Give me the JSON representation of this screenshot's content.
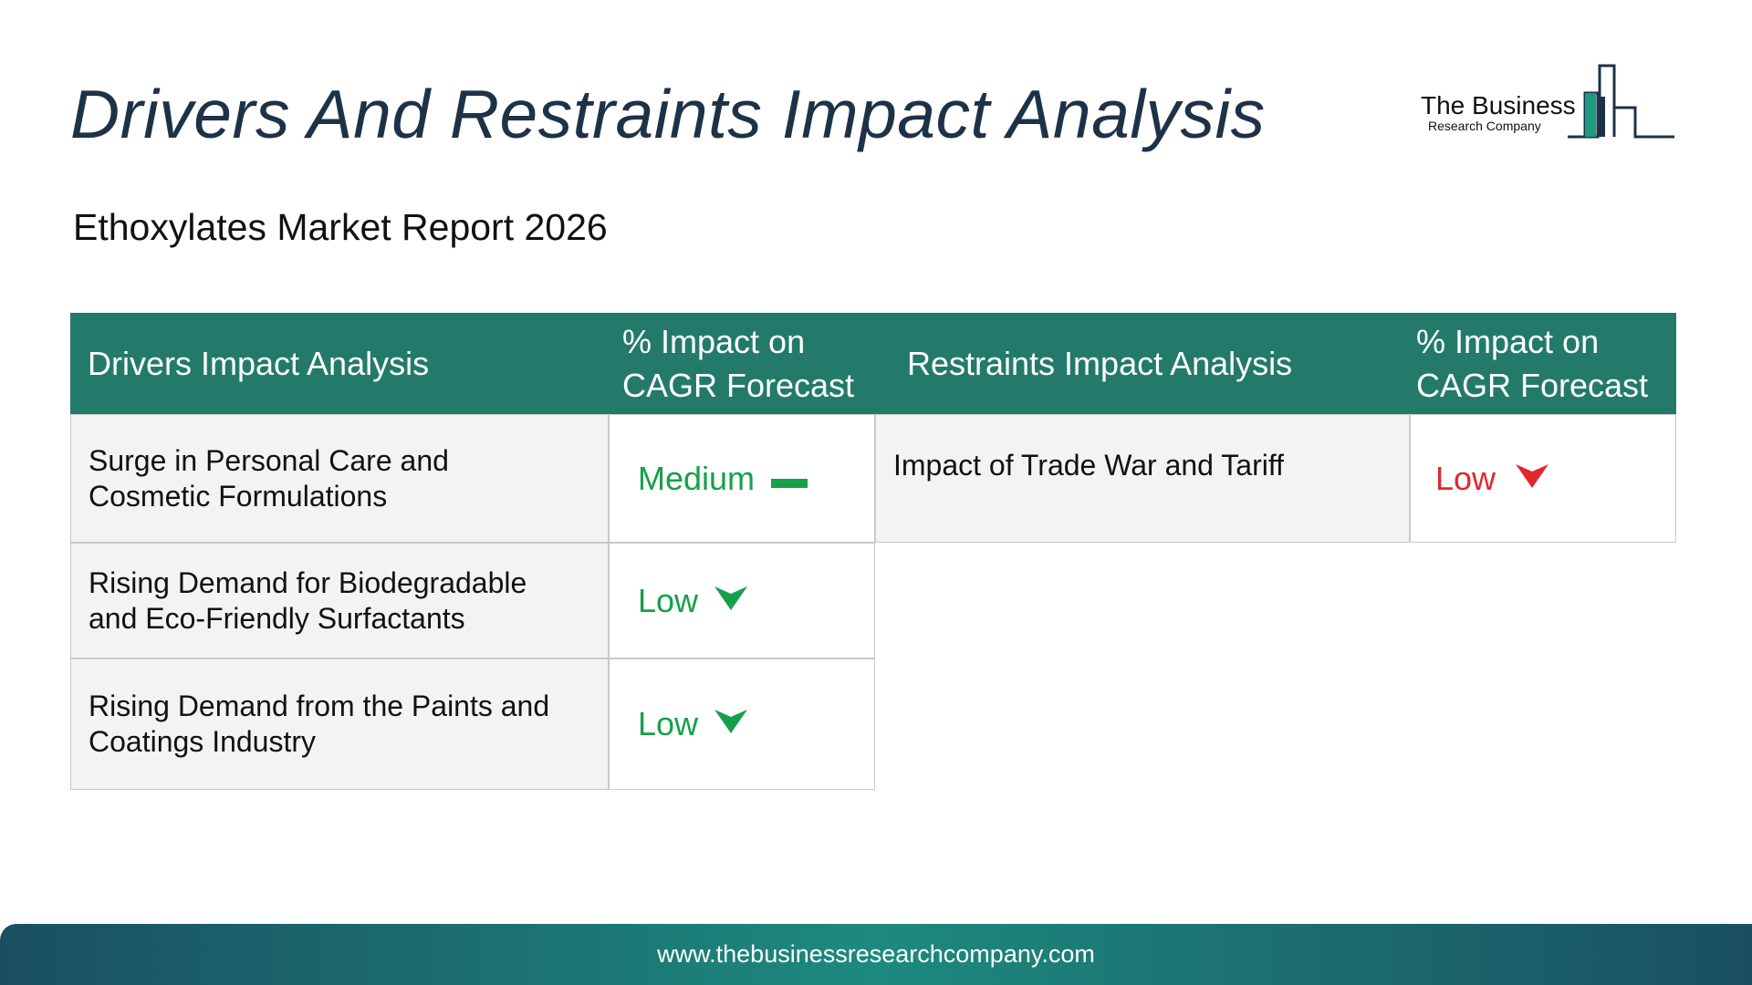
{
  "header": {
    "title": "Drivers And Restraints Impact Analysis",
    "subtitle": "Ethoxylates Market Report 2026"
  },
  "logo": {
    "line1": "The Business",
    "line2": "Research Company"
  },
  "table": {
    "headers": {
      "drivers": "Drivers Impact Analysis",
      "drivers_impact": "% Impact on CAGR Forecast",
      "restraints": "Restraints Impact Analysis",
      "restraints_impact": "% Impact on CAGR Forecast"
    },
    "drivers": [
      {
        "name": "Surge in Personal Care and Cosmetic Formulations",
        "impact": "Medium",
        "indicator": "dash-icon",
        "color": "#16a04a"
      },
      {
        "name": "Rising Demand for Biodegradable and Eco-Friendly Surfactants",
        "impact": "Low",
        "indicator": "arrow-down-icon",
        "color": "#16a04a"
      },
      {
        "name": "Rising Demand from the Paints and Coatings Industry",
        "impact": "Low",
        "indicator": "arrow-down-icon",
        "color": "#16a04a"
      }
    ],
    "restraints": [
      {
        "name": "Impact of Trade War and Tariff",
        "impact": "Low",
        "indicator": "arrow-down-icon",
        "color": "#e3262d"
      }
    ]
  },
  "colors": {
    "header_bg": "#237a6b",
    "title": "#1e3247",
    "row_bg": "#f2f3f5"
  },
  "footer": {
    "url": "www.thebusinessresearchcompany.com"
  }
}
